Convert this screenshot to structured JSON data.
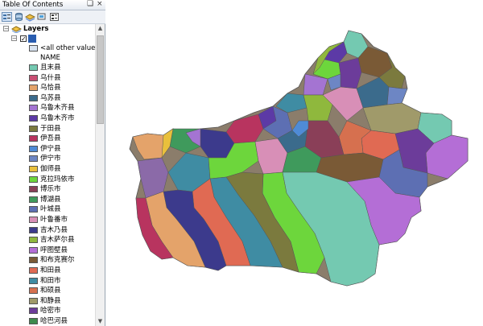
{
  "window": {
    "title": "Table Of Contents",
    "pin_glyph": "❑",
    "close_glyph": "×"
  },
  "toolbar": {
    "buttons": [
      "list-by-drawing-order-icon",
      "list-by-source-icon",
      "list-by-visibility-icon",
      "list-by-selection-icon",
      "options-icon"
    ]
  },
  "tree": {
    "data_frame_label": "Layers",
    "layer_name": "",
    "other_values_label": "<all other values>",
    "field_name": "NAME",
    "other_values_color": "#d9e4f2"
  },
  "legend": [
    {
      "label": "且末县",
      "color": "#74c9b1"
    },
    {
      "label": "乌什县",
      "color": "#c94e73"
    },
    {
      "label": "乌恰县",
      "color": "#e4a36a"
    },
    {
      "label": "乌苏县",
      "color": "#3b6b8c"
    },
    {
      "label": "乌鲁木齐县",
      "color": "#a474d2"
    },
    {
      "label": "乌鲁木齐市",
      "color": "#5c3aa6"
    },
    {
      "label": "于田县",
      "color": "#7b7a3e"
    },
    {
      "label": "伊吾县",
      "color": "#b8345f"
    },
    {
      "label": "伊宁县",
      "color": "#4f8bd6"
    },
    {
      "label": "伊宁市",
      "color": "#6d86c4"
    },
    {
      "label": "伽师县",
      "color": "#e9c03c"
    },
    {
      "label": "克拉玛依市",
      "color": "#6dd63c"
    },
    {
      "label": "博乐市",
      "color": "#8a3f58"
    },
    {
      "label": "博湖县",
      "color": "#3f9a5c"
    },
    {
      "label": "叶城县",
      "color": "#5d6fb3"
    },
    {
      "label": "叶鲁番市",
      "color": "#d88fb7"
    },
    {
      "label": "吉木乃县",
      "color": "#3c3a8c"
    },
    {
      "label": "吉木萨尔县",
      "color": "#8fb83d"
    },
    {
      "label": "呼图壁县",
      "color": "#b46ed6"
    },
    {
      "label": "和布克赛尔",
      "color": "#7a5a36"
    },
    {
      "label": "和田县",
      "color": "#e06a53"
    },
    {
      "label": "和田市",
      "color": "#3f8ca3"
    },
    {
      "label": "和硕县",
      "color": "#d6704f"
    },
    {
      "label": "和静县",
      "color": "#a09a6a"
    },
    {
      "label": "哈密市",
      "color": "#6c3c9a"
    },
    {
      "label": "哈巴河县",
      "color": "#3e8a4d"
    },
    {
      "label": "喀什市",
      "color": "#8b6aa8"
    }
  ]
}
